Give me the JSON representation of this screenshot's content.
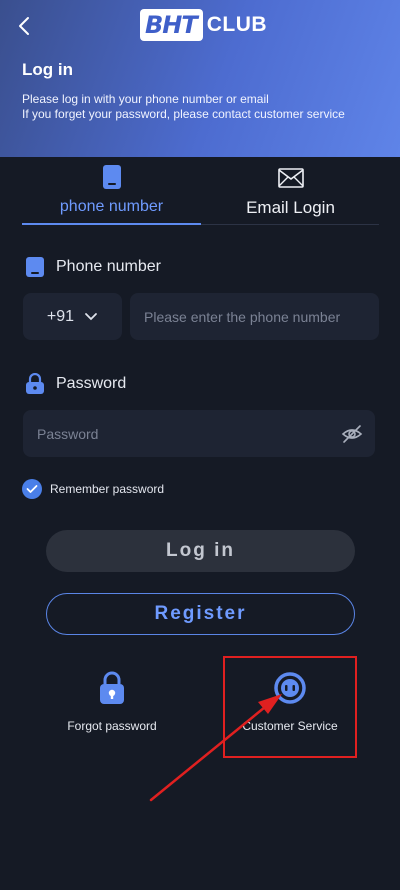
{
  "header": {
    "logo_main": "BHT",
    "logo_sub": "CLUB",
    "title": "Log in",
    "description_line1": "Please log in with your phone number or email",
    "description_line2": "If you forget your password, please contact customer service"
  },
  "tabs": [
    {
      "label": "phone number",
      "icon": "phone-icon",
      "active": true
    },
    {
      "label": "Email Login",
      "icon": "envelope-icon",
      "active": false
    }
  ],
  "phone_field": {
    "label": "Phone number",
    "country_code": "+91",
    "placeholder": "Please enter the phone number"
  },
  "password_field": {
    "label": "Password",
    "placeholder": "Password"
  },
  "remember": {
    "label": "Remember password",
    "checked": true
  },
  "buttons": {
    "login": "Log in",
    "register": "Register"
  },
  "bottom_links": {
    "forgot": "Forgot password",
    "service": "Customer Service"
  },
  "colors": {
    "accent": "#5d8af0",
    "background": "#151a25",
    "header_gradient_start": "#3a4f8e",
    "header_gradient_end": "#5f84e8",
    "annotation": "#e02020"
  }
}
